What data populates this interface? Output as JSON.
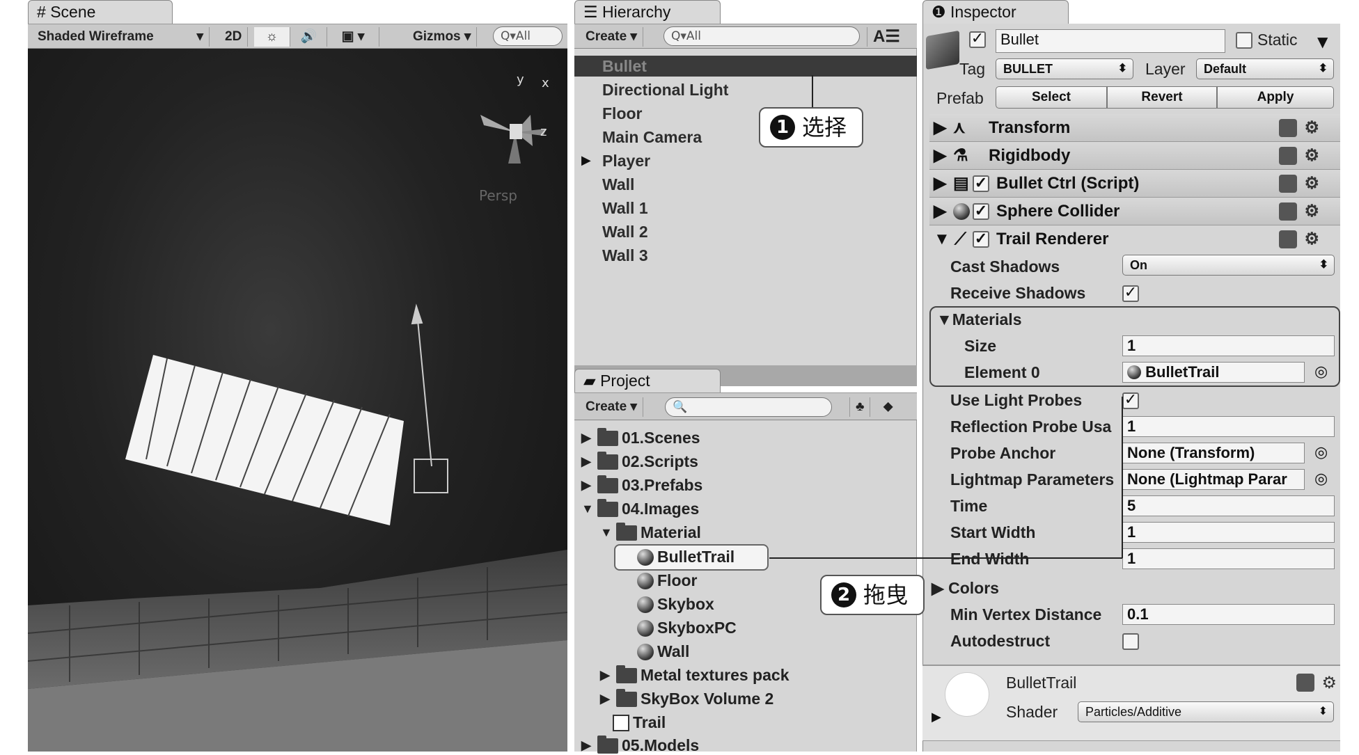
{
  "scene": {
    "tab": "Scene",
    "toolbar": {
      "draw_mode": "Shaded Wireframe",
      "mode_2d": "2D",
      "gizmos": "Gizmos",
      "search_placeholder": "All"
    },
    "gizmo_axes": {
      "x": "x",
      "y": "y",
      "z": "z"
    },
    "projection": "Persp"
  },
  "hierarchy": {
    "tab": "Hierarchy",
    "create": "Create",
    "search_placeholder": "All",
    "items": [
      "Bullet",
      "Directional Light",
      "Floor",
      "Main Camera",
      "Player",
      "Wall",
      "Wall 1",
      "Wall 2",
      "Wall 3"
    ]
  },
  "project": {
    "tab": "Project",
    "create": "Create",
    "items": {
      "f01": "01.Scenes",
      "f02": "02.Scripts",
      "f03": "03.Prefabs",
      "f04": "04.Images",
      "material": "Material",
      "m1": "BulletTrail",
      "m2": "Floor",
      "m3": "Skybox",
      "m4": "SkyboxPC",
      "m5": "Wall",
      "metal": "Metal textures pack",
      "skybox": "SkyBox Volume 2",
      "trail": "Trail",
      "f05": "05.Models"
    }
  },
  "inspector": {
    "tab": "Inspector",
    "object_name": "Bullet",
    "static_label": "Static",
    "tag_label": "Tag",
    "tag_value": "BULLET",
    "layer_label": "Layer",
    "layer_value": "Default",
    "prefab_label": "Prefab",
    "prefab_select": "Select",
    "prefab_revert": "Revert",
    "prefab_apply": "Apply",
    "components": [
      "Transform",
      "Rigidbody",
      "Bullet Ctrl (Script)",
      "Sphere Collider",
      "Trail Renderer"
    ],
    "trail": {
      "cast_shadows_label": "Cast Shadows",
      "cast_shadows_value": "On",
      "receive_shadows_label": "Receive Shadows",
      "materials_label": "Materials",
      "size_label": "Size",
      "size_value": "1",
      "element0_label": "Element 0",
      "element0_value": "BulletTrail",
      "light_probes_label": "Use Light Probes",
      "reflection_label": "Reflection Probe Usa",
      "reflection_value": "1",
      "probe_anchor_label": "Probe Anchor",
      "probe_anchor_value": "None (Transform)",
      "lightmap_label": "Lightmap Parameters",
      "lightmap_value": "None (Lightmap Parar",
      "time_label": "Time",
      "time_value": "5",
      "start_width_label": "Start Width",
      "start_width_value": "1",
      "end_width_label": "End Width",
      "end_width_value": "1",
      "colors_label": "Colors",
      "min_vertex_label": "Min Vertex Distance",
      "min_vertex_value": "0.1",
      "autodestruct_label": "Autodestruct"
    },
    "material": {
      "name": "BulletTrail",
      "shader_label": "Shader",
      "shader_value": "Particles/Additive"
    }
  },
  "callouts": {
    "one_num": "1",
    "one_text": "选择",
    "two_num": "2",
    "two_text": "拖曳"
  }
}
